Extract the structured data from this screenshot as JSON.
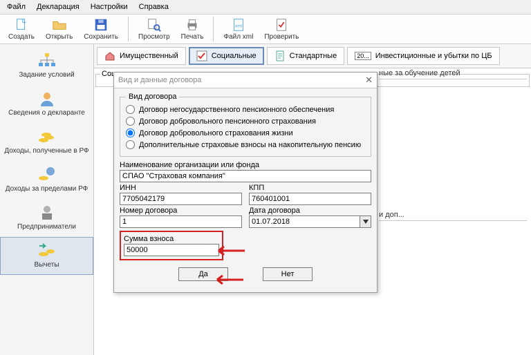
{
  "menu": {
    "file": "Файл",
    "decl": "Декларация",
    "settings": "Настройки",
    "help": "Справка"
  },
  "toolbar": {
    "create": "Создать",
    "open": "Открыть",
    "save": "Сохранить",
    "preview": "Просмотр",
    "print": "Печать",
    "xml": "Файл xml",
    "check": "Проверить"
  },
  "tabs": {
    "prop": "Имущественный",
    "social": "Социальные",
    "standard": "Стандартные",
    "invest": "Инвестиционные и убытки по ЦБ",
    "invest_badge": "20..."
  },
  "sidebar": {
    "s0": "Задание условий",
    "s1": "Сведения о декларанте",
    "s2": "Доходы, полученные в РФ",
    "s3": "Доходы за пределами РФ",
    "s4": "Предприниматели",
    "s5": "Вычеты"
  },
  "panel": {
    "legend": "Социальные налоговые вычеты"
  },
  "extra": {
    "header": "ные за обучение детей",
    "row": "и доп..."
  },
  "dialog": {
    "title": "Вид и данные договора",
    "group": "Вид договора",
    "r0": "Договор негосударственного пенсионного обеспечения",
    "r1": "Договор добровольного пенсионного страхования",
    "r2": "Договор добровольного страхования жизни",
    "r3": "Дополнительные страховые взносы на накопительную пенсию",
    "org_label": "Наименование организации или фонда",
    "org_value": "СПАО \"Страховая компания\"",
    "inn_label": "ИНН",
    "inn_value": "7705042179",
    "kpp_label": "КПП",
    "kpp_value": "760401001",
    "num_label": "Номер договора",
    "num_value": "1",
    "date_label": "Дата договора",
    "date_value": "01.07.2018",
    "sum_label": "Сумма взноса",
    "sum_value": "50000",
    "yes": "Да",
    "no": "Нет"
  }
}
